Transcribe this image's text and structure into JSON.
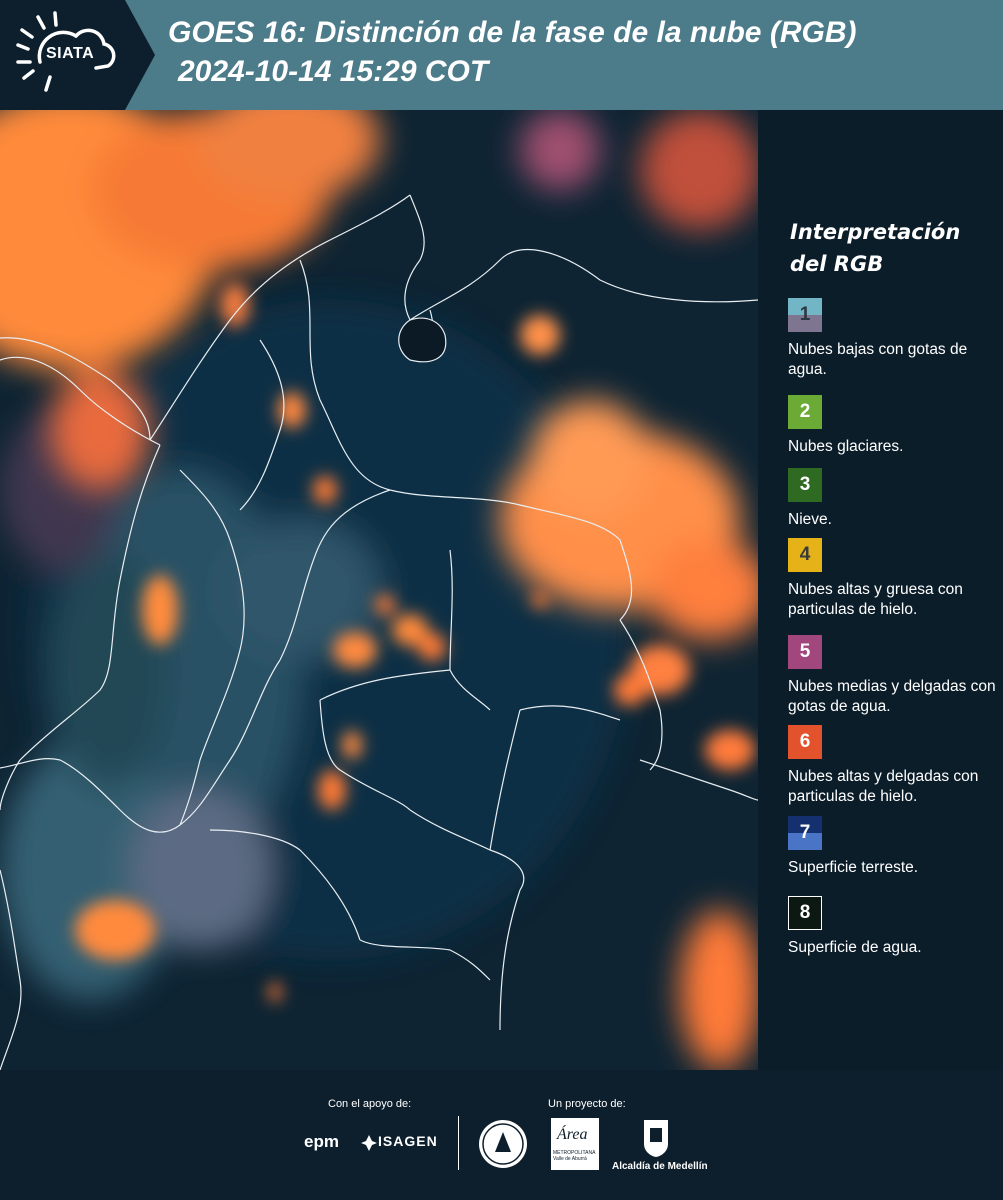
{
  "header": {
    "logo_text": "SIATA",
    "title_line1": "GOES 16: Distinción de la fase de la nube (RGB)",
    "title_line2": "2024-10-14 15:29 COT"
  },
  "legend": {
    "title": "Interpretación del RGB",
    "items": [
      {
        "number": "1",
        "label": "Nubes bajas con gotas de agua.",
        "color_top": "#72b6c6",
        "color_bottom": "#7e7690"
      },
      {
        "number": "2",
        "label": "Nubes glaciares.",
        "color": "#6bab35"
      },
      {
        "number": "3",
        "label": "Nieve.",
        "color": "#2f6a22"
      },
      {
        "number": "4",
        "label": "Nubes altas y gruesa con particulas de hielo.",
        "color": "#e5b318"
      },
      {
        "number": "5",
        "label": "Nubes medias y delgadas con gotas de agua.",
        "color": "#a2467e"
      },
      {
        "number": "6",
        "label": "Nubes altas y delgadas con particulas de hielo.",
        "color": "#e2532d"
      },
      {
        "number": "7",
        "label": "Superficie terreste.",
        "color_top": "#15306e",
        "color_bottom": "#4a74c6"
      },
      {
        "number": "8",
        "label": "Superficie de agua.",
        "color": "#0b1912"
      }
    ]
  },
  "footer": {
    "support_label": "Con el apoyo de:",
    "project_label": "Un proyecto de:",
    "sponsor1": "epm",
    "sponsor2": "ISAGEN",
    "org_area": "Área",
    "org_area_sub": "METROPOLITANA Valle de Aburrá",
    "org_alcaldia": "Alcaldía de Medellín"
  }
}
